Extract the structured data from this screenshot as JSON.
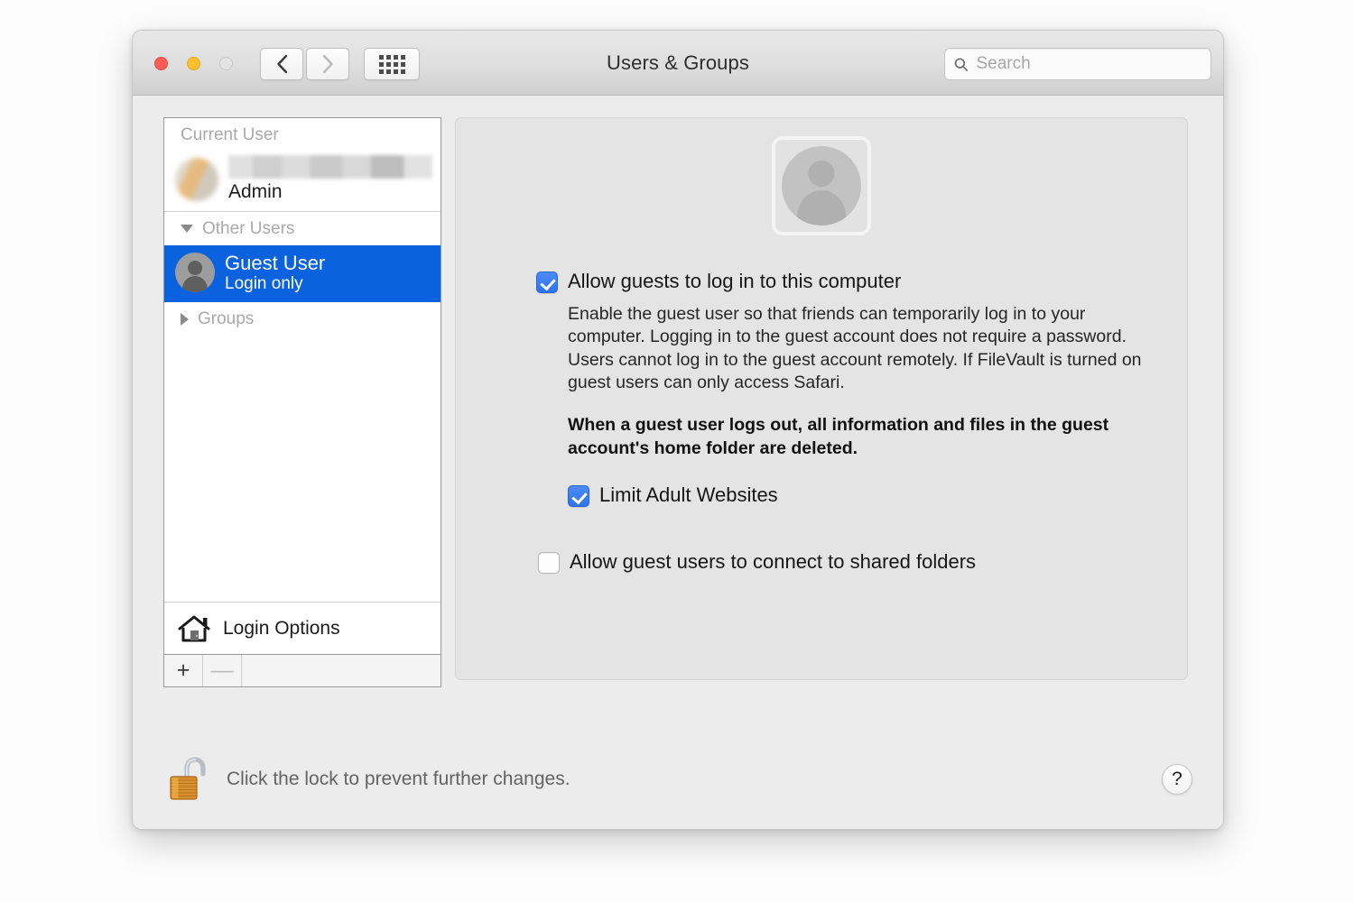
{
  "window": {
    "title": "Users & Groups",
    "traffic_lights": [
      "close",
      "minimize",
      "zoom"
    ],
    "nav": {
      "back": "back-chevron",
      "forward": "forward-chevron",
      "grid": "show-all-grid"
    },
    "search": {
      "value": "",
      "placeholder": "Search",
      "icon": "search-icon"
    }
  },
  "sidebar": {
    "current_user_header": "Current User",
    "current_user": {
      "name_redacted": true,
      "role": "Admin",
      "avatar": "blurred-user-avatar"
    },
    "other_users_header": "Other Users",
    "other_users_expanded": true,
    "selected_user": {
      "name": "Guest User",
      "subtitle": "Login only",
      "avatar": "person-silhouette-avatar",
      "selected": true
    },
    "groups_header": "Groups",
    "groups_expanded": false,
    "login_options": {
      "label": "Login Options",
      "icon": "home-icon"
    },
    "footer": {
      "add": "+",
      "remove": "—",
      "remove_disabled": true
    }
  },
  "panel": {
    "avatar": "guest-user-placeholder-avatar",
    "options": [
      {
        "label": "Allow guests to log in to this computer",
        "checked": true,
        "description": "Enable the guest user so that friends can temporarily log in to your computer. Logging in to the guest account does not require a password. Users cannot log in to the guest account remotely. If FileVault is turned on guest users can only access Safari.",
        "warning": "When a guest user logs out, all information and files in the guest account's home folder are deleted."
      },
      {
        "label": "Limit Adult Websites",
        "checked": true
      },
      {
        "label": "Allow guest users to connect to shared folders",
        "checked": false
      }
    ]
  },
  "footer": {
    "lock_icon": "unlocked-padlock-icon",
    "lock_text": "Click the lock to prevent further changes.",
    "help_label": "?"
  },
  "colors": {
    "selection_blue": "#0a62de",
    "checkbox_blue": "#2e74ef",
    "window_body": "#ececec",
    "panel_bg": "#e4e4e4",
    "traffic_close": "#fb5d56",
    "traffic_min": "#fcc02e",
    "traffic_zoom_disabled": "#e3e3e3"
  }
}
